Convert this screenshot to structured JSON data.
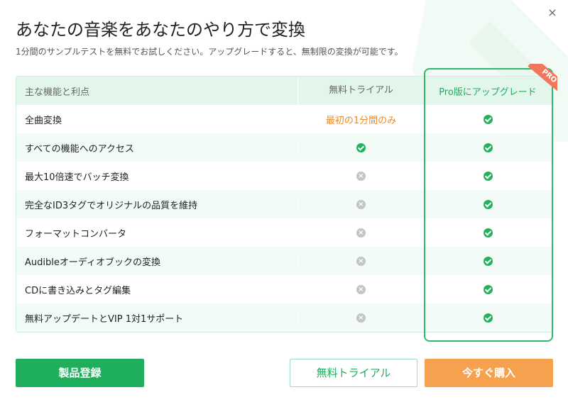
{
  "header": {
    "title": "あなたの音楽をあなたのやり方で変換",
    "subtitle": "1分間のサンプルテストを無料でお試しください。アップグレードすると、無制限の変換が可能です。",
    "close_label": "×"
  },
  "table": {
    "columns": [
      "主な機能と利点",
      "無料トライアル",
      "Pro版にアップグレード"
    ],
    "pro_badge": "PRO",
    "rows": [
      {
        "feature": "全曲変換",
        "trial": "最初の1分間のみ",
        "trial_type": "text",
        "pro": "check"
      },
      {
        "feature": "すべての機能へのアクセス",
        "trial": "check",
        "trial_type": "check",
        "pro": "check"
      },
      {
        "feature": "最大10倍速でバッチ変換",
        "trial": "cross",
        "trial_type": "cross",
        "pro": "check"
      },
      {
        "feature": "完全なID3タグでオリジナルの品質を維持",
        "trial": "cross",
        "trial_type": "cross",
        "pro": "check"
      },
      {
        "feature": "フォーマットコンバータ",
        "trial": "cross",
        "trial_type": "cross",
        "pro": "check"
      },
      {
        "feature": "Audibleオーディオブックの変換",
        "trial": "cross",
        "trial_type": "cross",
        "pro": "check"
      },
      {
        "feature": "CDに書き込みとタグ編集",
        "trial": "cross",
        "trial_type": "cross",
        "pro": "check"
      },
      {
        "feature": "無料アップデートとVIP 1対1サポート",
        "trial": "cross",
        "trial_type": "cross",
        "pro": "check"
      }
    ]
  },
  "buttons": {
    "register": "製品登録",
    "trial": "無料トライアル",
    "buy": "今すぐ購入"
  },
  "colors": {
    "accent_green": "#1fae5c",
    "accent_orange": "#f6a14d",
    "ribbon": "#f2765c"
  }
}
